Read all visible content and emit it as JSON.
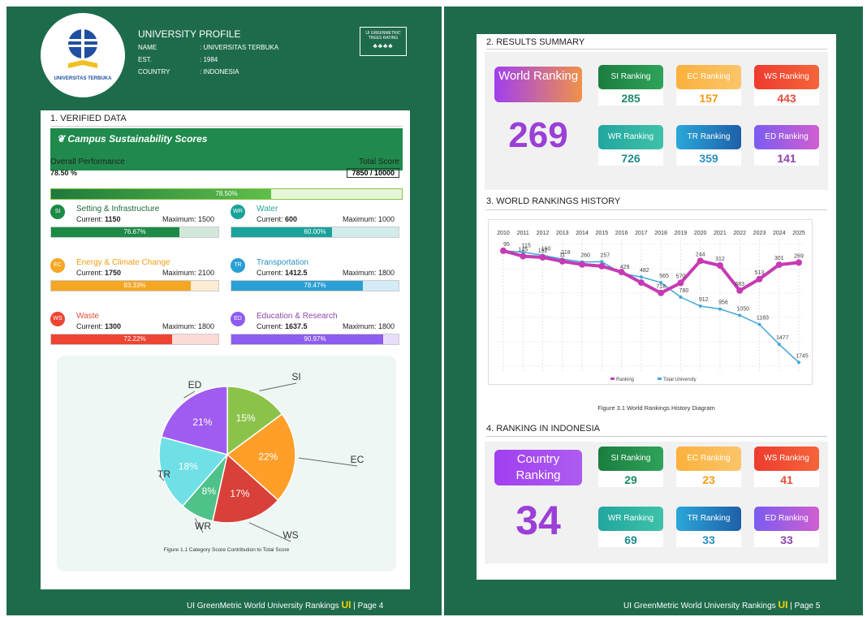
{
  "page4": {
    "profile_title": "UNIVERSITY PROFILE",
    "logo_text": "UNIVERSITAS TERBUKA",
    "rows": [
      {
        "k": "NAME",
        "v": ": UNIVERSITAS TERBUKA"
      },
      {
        "k": "EST.",
        "v": ": 1984"
      },
      {
        "k": "COUNTRY",
        "v": ": INDONESIA"
      }
    ],
    "badge": {
      "line1": "UI GREENMETRIC",
      "line2": "TREES RATING",
      "trees": "♣♣♣♣"
    },
    "section_title": "1. VERIFIED DATA",
    "scores_heading": "Campus Sustainability Scores",
    "overall_label": "Overall Performance",
    "overall_value": "78.50 %",
    "total_label": "Total Score",
    "total_value": "7850 / 10000",
    "overall_bar_label": "78.50%",
    "overall_fraction": 0.785,
    "metrics": [
      {
        "code": "SI",
        "name": "Setting & Infrastructure",
        "cur_label": "Current:",
        "cur": "1150",
        "max": "Maximum: 1500",
        "pct": "76.67%",
        "fraction": 0.7667,
        "color": "#1d8a46",
        "text_color": "#1d6b3a"
      },
      {
        "code": "WR",
        "name": "Water",
        "cur_label": "Current:",
        "cur": "600",
        "max": "Maximum: 1000",
        "pct": "60.00%",
        "fraction": 0.6,
        "color": "#1aa39a",
        "text_color": "#26a69a"
      },
      {
        "code": "EC",
        "name": "Energy & Climate Change",
        "cur_label": "Current:",
        "cur": "1750",
        "max": "Maximum: 2100",
        "pct": "83.33%",
        "fraction": 0.8333,
        "color": "#f5a623",
        "text_color": "#f39c12"
      },
      {
        "code": "TR",
        "name": "Transportation",
        "cur_label": "Current:",
        "cur": "1412.5",
        "max": "Maximum: 1800",
        "pct": "78.47%",
        "fraction": 0.7847,
        "color": "#2a9fd6",
        "text_color": "#2a8fc6"
      },
      {
        "code": "WS",
        "name": "Waste",
        "cur_label": "Current:",
        "cur": "1300",
        "max": "Maximum: 1800",
        "pct": "72.22%",
        "fraction": 0.7222,
        "color": "#ee4433",
        "text_color": "#e74c3c"
      },
      {
        "code": "ED",
        "name": "Education & Research",
        "cur_label": "Current:",
        "cur": "1637.5",
        "max": "Maximum: 1800",
        "pct": "90.97%",
        "fraction": 0.9097,
        "color": "#8e5cf0",
        "text_color": "#8e44ad"
      }
    ],
    "pie_caption": "Figure 1.1 Category Score Contribution to Total Score",
    "footer": "UI GreenMetric World University Rankings",
    "ui_logo": "UI",
    "page_label": "| Page 4"
  },
  "chart_data": [
    {
      "type": "pie",
      "categories": [
        "SI",
        "EC",
        "WS",
        "WR",
        "TR",
        "ED"
      ],
      "values": [
        15,
        22,
        17,
        8,
        18,
        21
      ],
      "labels": [
        "15%",
        "22%",
        "17%",
        "8%",
        "18%",
        "21%"
      ],
      "colors": [
        "#8bc34a",
        "#ff9f2a",
        "#d9403a",
        "#4fc28a",
        "#6fe0e6",
        "#a05cf0"
      ],
      "title": ""
    },
    {
      "type": "line",
      "x": [
        2010,
        2011,
        2012,
        2013,
        2014,
        2015,
        2016,
        2017,
        2018,
        2019,
        2020,
        2021,
        2022,
        2023,
        2024,
        2025
      ],
      "series": [
        {
          "name": "Ranking",
          "values": [
            95,
            175,
            192,
            251,
            297,
            322,
            409,
            565,
            718,
            570,
            244,
            312,
            683,
            513,
            301,
            269
          ],
          "color": "#c63bb4"
        },
        {
          "name": "Total University",
          "values": [
            95,
            115,
            160,
            218,
            260,
            257,
            429,
            482,
            565,
            780,
            912,
            956,
            1050,
            1183,
            1477,
            1745
          ],
          "color": "#44a8d8"
        }
      ],
      "point_labels": {
        "Ranking": [
          "",
          "145",
          "192",
          "11",
          "",
          "",
          "",
          "",
          "718",
          "570",
          "244",
          "312",
          "683",
          "513",
          "301",
          "269"
        ],
        "Total University": [
          "95",
          "115",
          "160",
          "218",
          "260",
          "257",
          "429",
          "482",
          "565",
          "780",
          "912",
          "956",
          "1050",
          "1183",
          "1477",
          "1745"
        ]
      },
      "ylim": [
        0,
        1800
      ],
      "inverted_y": true
    }
  ],
  "page5": {
    "s2_title": "2. RESULTS SUMMARY",
    "world_label": "World Ranking",
    "world_value": "269",
    "world_rankings": [
      {
        "label": "SI Ranking",
        "value": "285",
        "bg": "linear-gradient(90deg,#1b7d3f,#2ea35a)",
        "color": "#1d8a6b"
      },
      {
        "label": "EC Ranking",
        "value": "157",
        "bg": "linear-gradient(90deg,#fbb13c,#fbc56a)",
        "color": "#f39c12"
      },
      {
        "label": "WS Ranking",
        "value": "443",
        "bg": "linear-gradient(90deg,#ee3b2e,#f5653b)",
        "color": "#e74c3c"
      },
      {
        "label": "WR Ranking",
        "value": "726",
        "bg": "linear-gradient(90deg,#22a6a0,#3fc2a8)",
        "color": "#1d8a8a"
      },
      {
        "label": "TR Ranking",
        "value": "359",
        "bg": "linear-gradient(90deg,#2aa7d9,#1e5fa8)",
        "color": "#2a8fc6"
      },
      {
        "label": "ED Ranking",
        "value": "141",
        "bg": "linear-gradient(90deg,#7b5cf0,#d05fd0)",
        "color": "#8e44ad"
      }
    ],
    "s3_title": "3. WORLD RANKINGS HISTORY",
    "legend": [
      "Ranking",
      "Total University"
    ],
    "hist_caption": "Figure 3.1 World Rankings History Diagram",
    "s4_title": "4. RANKING IN INDONESIA",
    "country_label": "Country Ranking",
    "country_value": "34",
    "country_rankings": [
      {
        "label": "SI Ranking",
        "value": "29",
        "bg": "linear-gradient(90deg,#1b7d3f,#2ea35a)",
        "color": "#1d8a6b"
      },
      {
        "label": "EC Ranking",
        "value": "23",
        "bg": "linear-gradient(90deg,#fbb13c,#fbc56a)",
        "color": "#f39c12"
      },
      {
        "label": "WS Ranking",
        "value": "41",
        "bg": "linear-gradient(90deg,#ee3b2e,#f5653b)",
        "color": "#e74c3c"
      },
      {
        "label": "WR Ranking",
        "value": "69",
        "bg": "linear-gradient(90deg,#22a6a0,#3fc2a8)",
        "color": "#1d8a8a"
      },
      {
        "label": "TR Ranking",
        "value": "33",
        "bg": "linear-gradient(90deg,#2aa7d9,#1e5fa8)",
        "color": "#2a8fc6"
      },
      {
        "label": "ED Ranking",
        "value": "33",
        "bg": "linear-gradient(90deg,#7b5cf0,#d05fd0)",
        "color": "#8e44ad"
      }
    ],
    "footer": "UI GreenMetric World University Rankings",
    "ui_logo": "UI",
    "page_label": "| Page 5"
  }
}
